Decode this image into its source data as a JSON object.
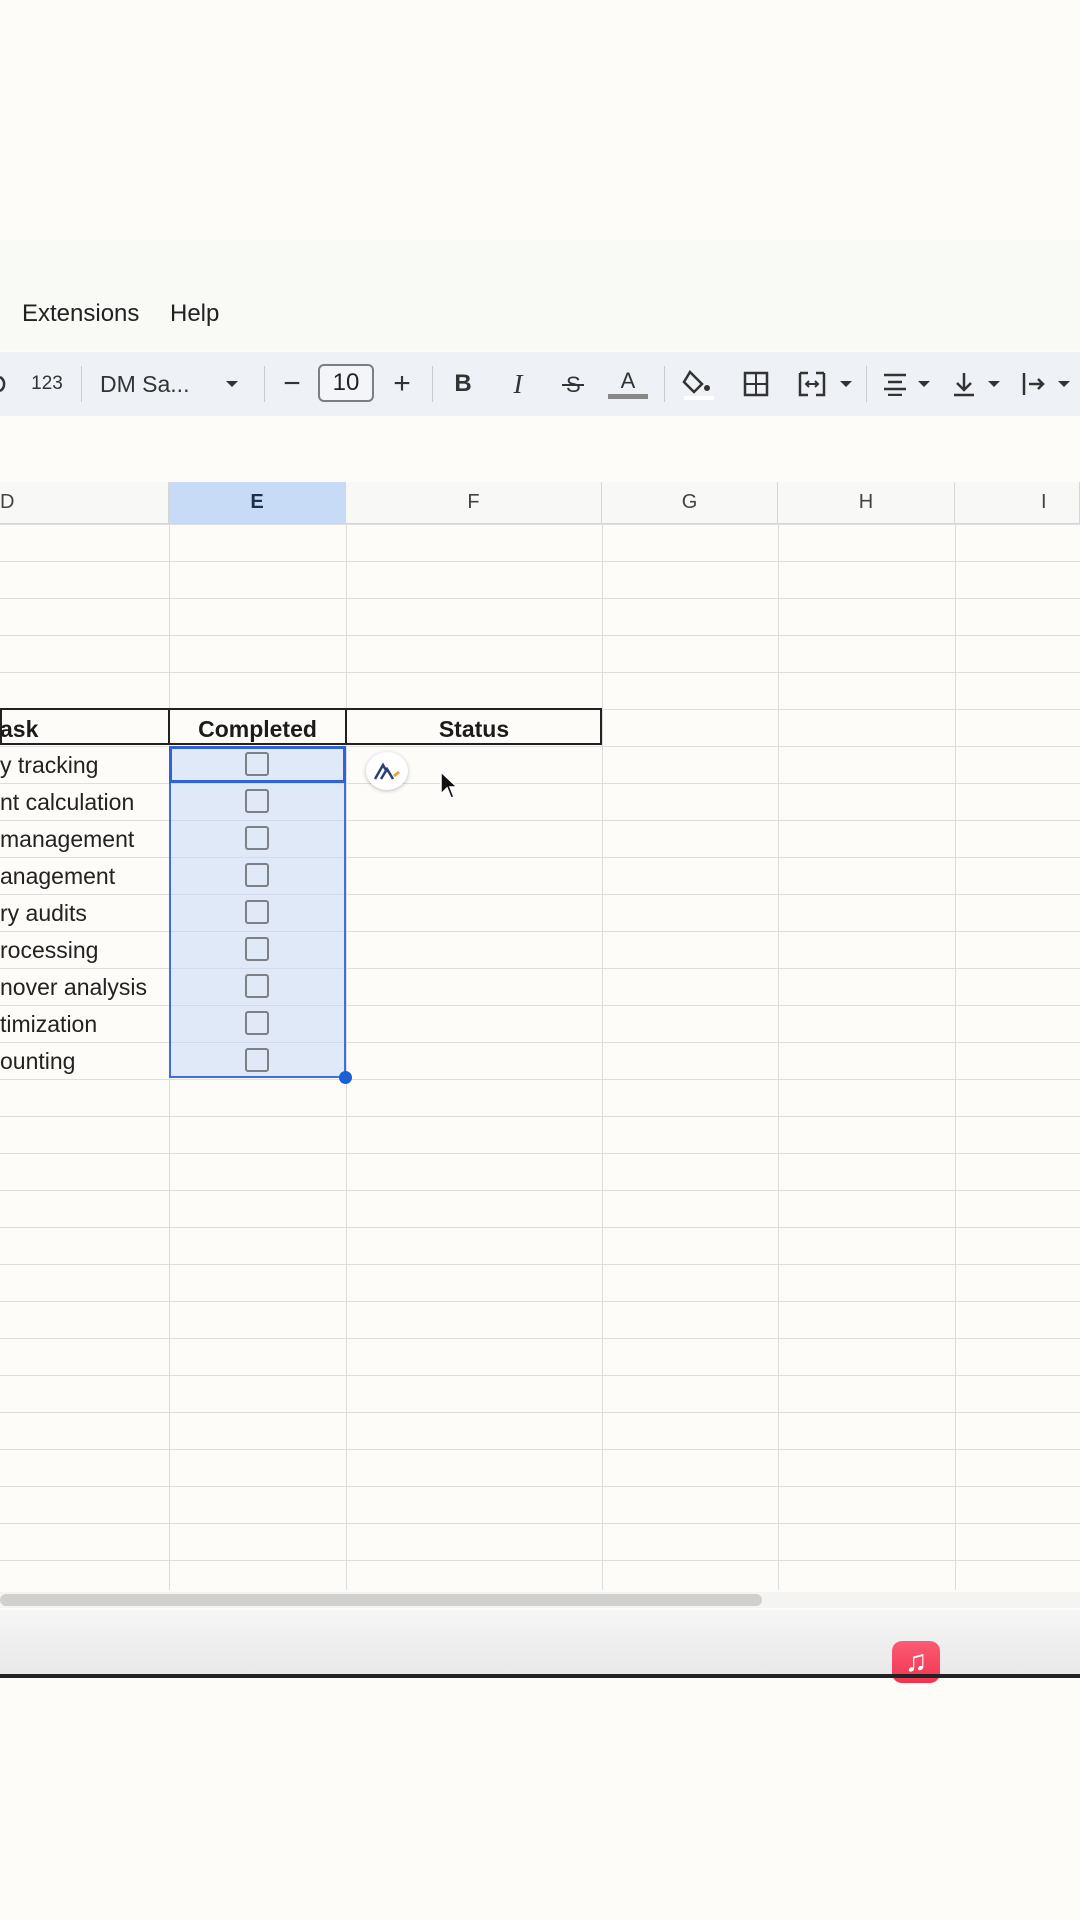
{
  "menu": {
    "items": [
      "Extensions",
      "Help"
    ]
  },
  "toolbar": {
    "format_number": "123",
    "font_name": "DM Sa...",
    "font_size": "10",
    "decrease": "−",
    "increase": "+",
    "bold": "B",
    "italic": "I",
    "text_color_glyph": "A"
  },
  "columns": [
    "D",
    "E",
    "F",
    "G",
    "H",
    "I"
  ],
  "selected_column": "E",
  "table": {
    "headers": {
      "task": "ask",
      "completed": "Completed",
      "status": "Status"
    },
    "tasks": [
      "y tracking",
      "nt calculation",
      " management",
      "anagement",
      "ry audits",
      "rocessing",
      "nover analysis",
      "timization",
      "ounting"
    ]
  },
  "colors": {
    "accent": "#2f63d6",
    "selection": "#c8dbf6",
    "music": "#f23450"
  }
}
